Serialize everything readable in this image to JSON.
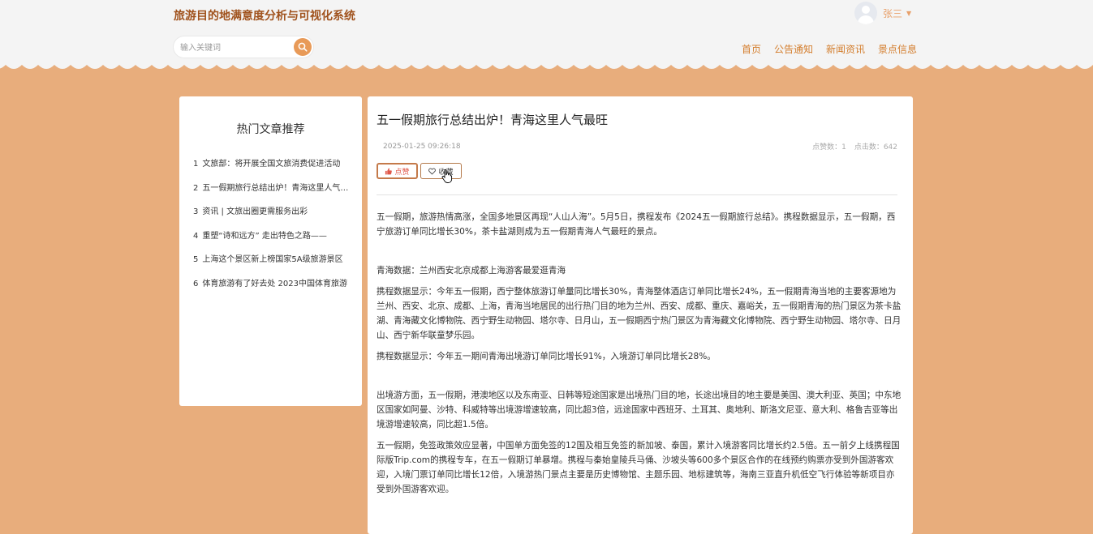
{
  "site": {
    "title": "旅游目的地满意度分析与可视化系统"
  },
  "user": {
    "name": "张三"
  },
  "search": {
    "placeholder": "输入关键词"
  },
  "nav": [
    "首页",
    "公告通知",
    "新闻资讯",
    "景点信息"
  ],
  "sidebar": {
    "title": "热门文章推荐",
    "items": [
      {
        "index": "1",
        "title": "文旅部：将开展全国文旅消费促进活动"
      },
      {
        "index": "2",
        "title": "五一假期旅行总结出炉！青海这里人气最旺"
      },
      {
        "index": "3",
        "title": "资讯 | 文旅出圈更需服务出彩"
      },
      {
        "index": "4",
        "title": "重塑“诗和远方” 走出特色之路——"
      },
      {
        "index": "5",
        "title": "上海这个景区新上榜国家5A级旅游景区"
      },
      {
        "index": "6",
        "title": "体育旅游有了好去处 2023中国体育旅游"
      }
    ]
  },
  "article": {
    "title": "五一假期旅行总结出炉！青海这里人气最旺",
    "date": "2025-01-25 09:26:18",
    "likes_label": "点赞数：1",
    "clicks_label": "点击数：642",
    "like_label": "点赞",
    "fav_label": "收藏",
    "paragraphs": [
      "五一假期，旅游热情高涨，全国多地景区再现“人山人海”。5月5日，携程发布《2024五一假期旅行总结》。携程数据显示，五一假期，西宁旅游订单同比增长30%，茶卡盐湖则成为五一假期青海人气最旺的景点。",
      "青海数据：兰州西安北京成都上海游客最爱逛青海",
      "携程数据显示：今年五一假期，西宁整体旅游订单量同比增长30%，青海整体酒店订单同比增长24%，五一假期青海当地的主要客源地为兰州、西安、北京、成都、上海，青海当地居民的出行热门目的地为兰州、西安、成都、重庆、嘉峪关，五一假期青海的热门景区为茶卡盐湖、青海藏文化博物院、西宁野生动物园、塔尔寺、日月山，五一假期西宁热门景区为青海藏文化博物院、西宁野生动物园、塔尔寺、日月山、西宁新华联童梦乐园。",
      "携程数据显示：今年五一期间青海出境游订单同比增长91%，入境游订单同比增长28%。",
      "出境游方面，五一假期，港澳地区以及东南亚、日韩等短途国家是出境热门目的地，长途出境目的地主要是美国、澳大利亚、英国；中东地区国家如阿曼、沙特、科威特等出境游增速较高，同比超3倍，远途国家中西班牙、土耳其、奥地利、斯洛文尼亚、意大利、格鲁吉亚等出境游增速较高，同比超1.5倍。",
      "五一假期，免签政策效应显著，中国单方面免签的12国及相互免签的新加坡、泰国，累计入境游客同比增长约2.5倍。五一前夕上线携程国际版Trip.com的携程专车，在五一假期订单暴增。携程与秦始皇陵兵马俑、沙坡头等600多个景区合作的在线预约购票亦受到外国游客欢迎，入境门票订单同比增长12倍，入境游热门景点主要是历史博物馆、主题乐园、地标建筑等，海南三亚直升机低空飞行体验等新项目亦受到外国游客欢迎。"
    ]
  },
  "colors": {
    "brand": "#a0521d",
    "accent": "#e89a58",
    "page_bg": "#e8ad7c",
    "nav": "#d37d2c"
  },
  "icons": [
    "user-avatar-icon",
    "caret-down-icon",
    "search-icon",
    "thumbs-up-icon",
    "heart-icon",
    "pointer-cursor-icon"
  ]
}
